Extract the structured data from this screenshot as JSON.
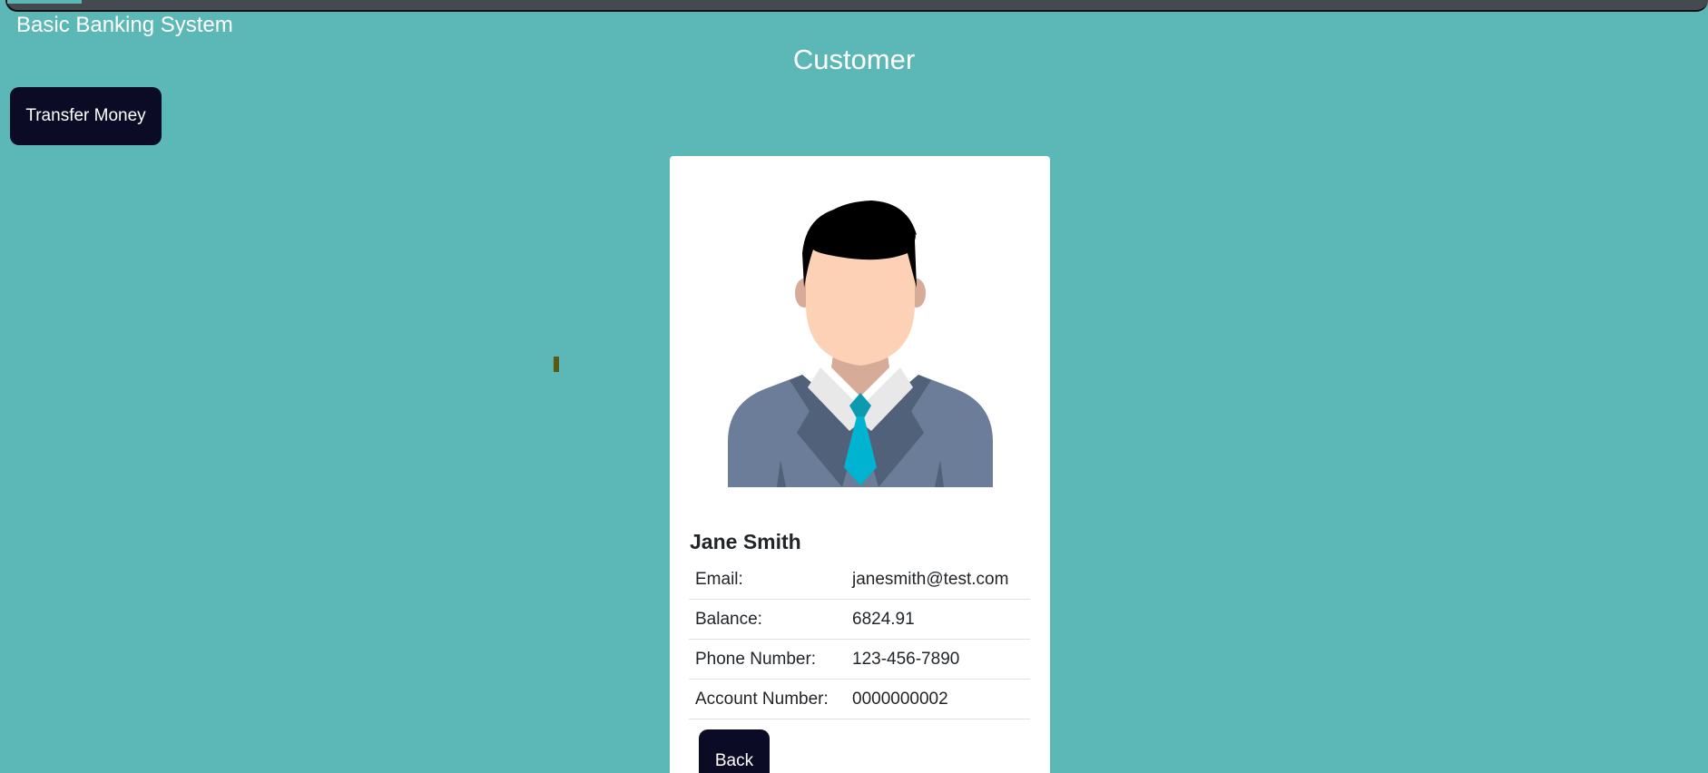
{
  "app": {
    "title": "Basic Banking System"
  },
  "page": {
    "title": "Customer"
  },
  "actions": {
    "transfer_label": "Transfer Money",
    "back_label": "Back"
  },
  "customer": {
    "name": "Jane Smith",
    "avatar_icon": "businessman-avatar-icon",
    "details": [
      {
        "label": "Email:",
        "value": "janesmith@test.com"
      },
      {
        "label": "Balance:",
        "value": "6824.91"
      },
      {
        "label": "Phone Number:",
        "value": "123-456-7890"
      },
      {
        "label": "Account Number:",
        "value": "0000000002"
      }
    ]
  },
  "colors": {
    "background": "#5cb8b7",
    "button": "#0c0b26",
    "card": "#ffffff",
    "text": "#212529"
  }
}
